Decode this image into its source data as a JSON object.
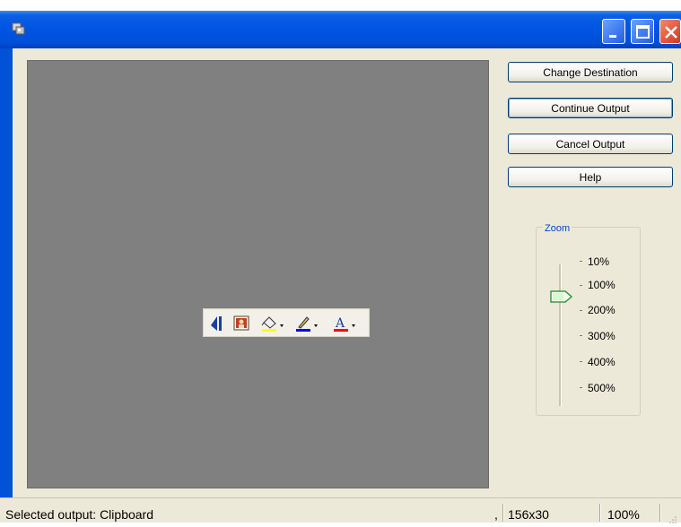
{
  "window": {
    "title": ""
  },
  "buttons": {
    "change_destination": "Change Destination",
    "continue_output": "Continue Output",
    "cancel_output": "Cancel Output",
    "help": "Help"
  },
  "zoom": {
    "legend": "Zoom",
    "levels": [
      "10%",
      "100%",
      "200%",
      "300%",
      "400%",
      "500%"
    ],
    "selected": "100%"
  },
  "preview_toolbar": {
    "icons": [
      "text-direction-icon",
      "picture-icon",
      "fill-color-icon",
      "line-color-icon",
      "font-color-icon"
    ],
    "colors": {
      "fill": "#ffff00",
      "line": "#0000ff",
      "font": "#ff0000"
    }
  },
  "status": {
    "selected_output": "Selected output:  Clipboard",
    "dimensions": "156x30",
    "zoom_level": "100%"
  },
  "colors": {
    "titlebar": "#0054e3",
    "preview_bg": "#808080",
    "dialog_bg": "#ece9d8"
  }
}
